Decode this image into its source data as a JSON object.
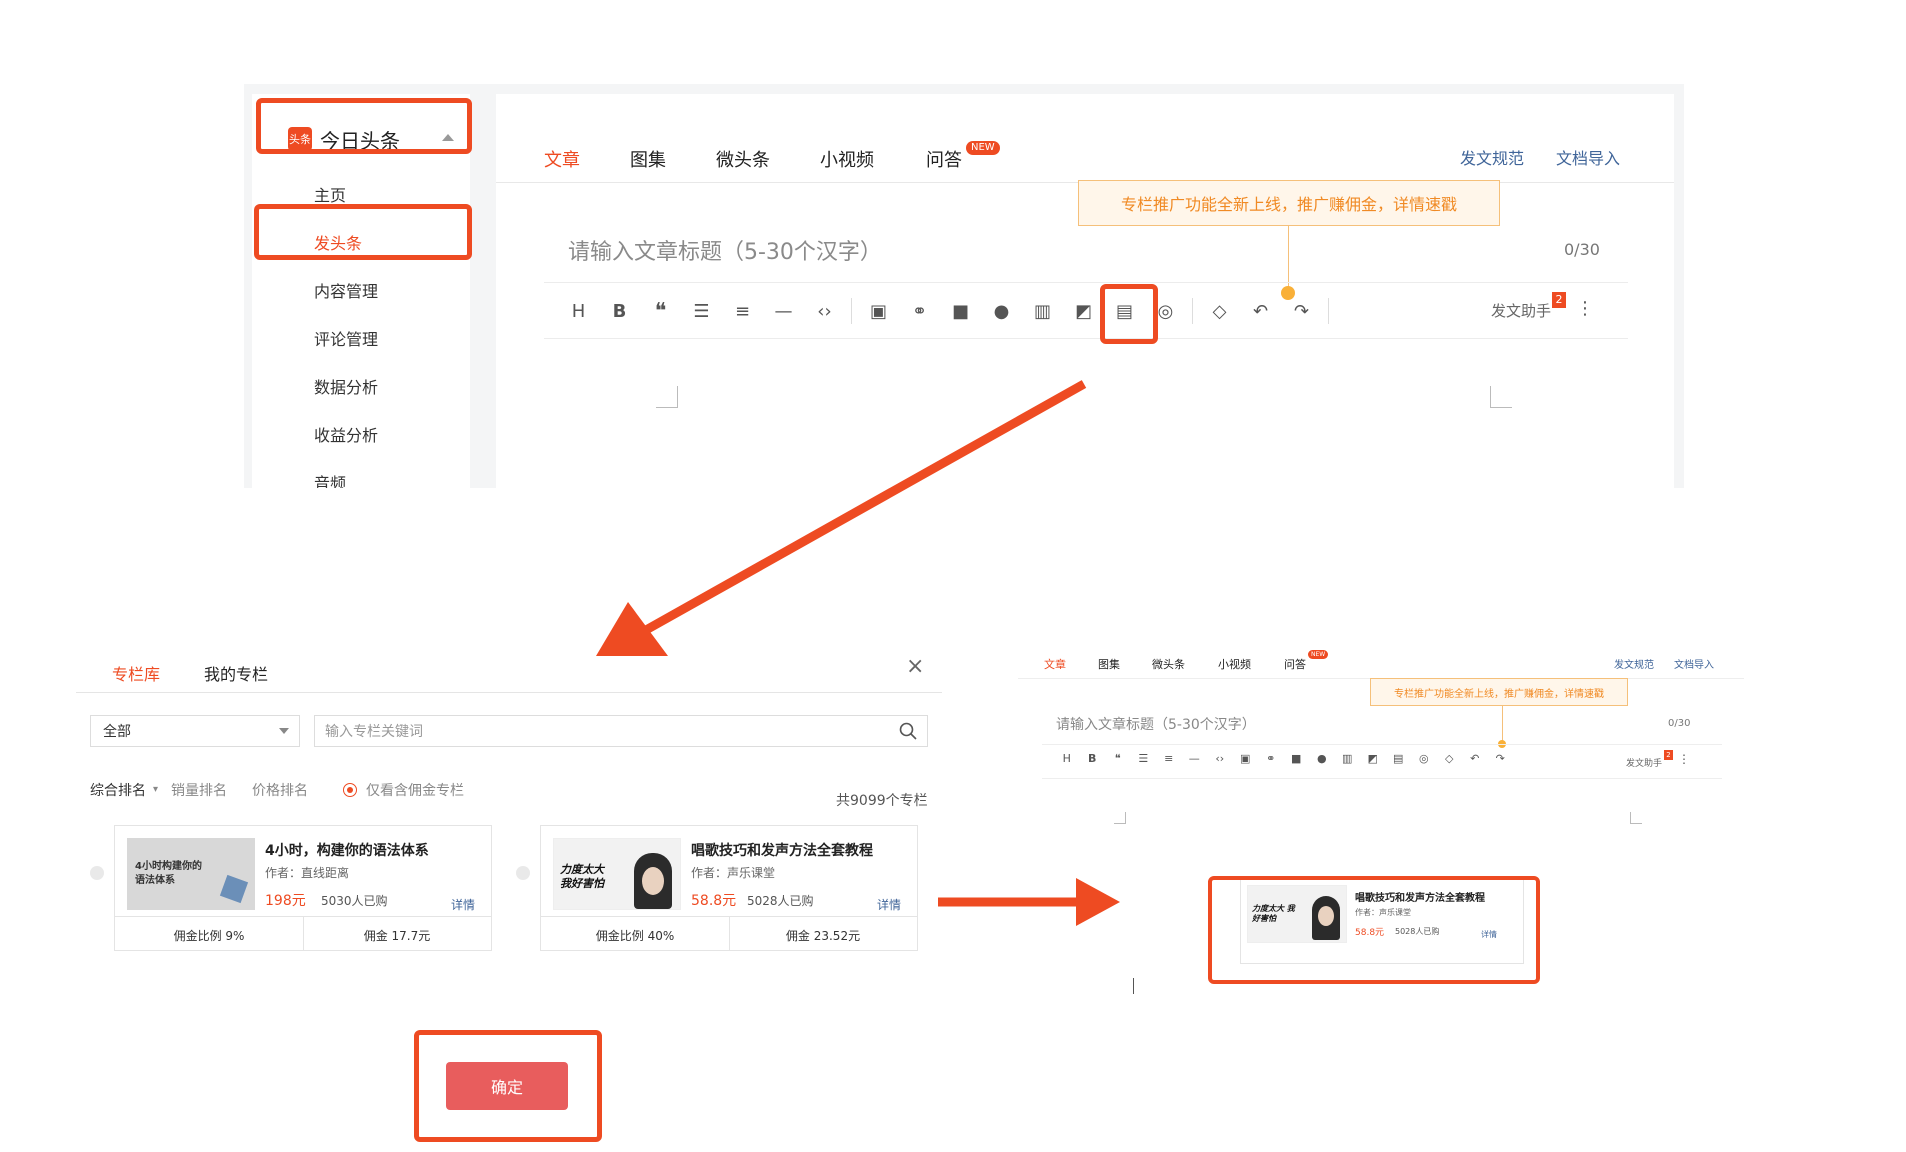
{
  "colors": {
    "accent": "#ee4b22",
    "link": "#406599",
    "tooltip_text": "#f08a24",
    "confirm": "#e85d5d"
  },
  "panel1": {
    "brand": {
      "logo": "头条",
      "name": "今日头条"
    },
    "nav": [
      "主页",
      "发头条",
      "内容管理",
      "评论管理",
      "数据分析",
      "收益分析",
      "音频"
    ],
    "tabs": [
      "文章",
      "图集",
      "微头条",
      "小视频",
      "问答"
    ],
    "new_badge": "NEW",
    "links": [
      "发文规范",
      "文档导入"
    ],
    "tooltip": "专栏推广功能全新上线，推广赚佣金，详情速戳",
    "title_placeholder": "请输入文章标题（5-30个汉字）",
    "title_count": "0/30",
    "toolbar_icons": [
      "heading-icon",
      "bold-icon",
      "quote-icon",
      "bullet-list-icon",
      "numbered-list-icon",
      "divider-icon",
      "code-icon",
      "image-icon",
      "link-icon",
      "video-icon",
      "audio-icon",
      "chart-icon",
      "gallery-icon",
      "column-icon",
      "vote-icon",
      "eraser-icon",
      "undo-icon",
      "redo-icon"
    ],
    "helper_label": "发文助手",
    "helper_badge": "2"
  },
  "panel2": {
    "tabs": [
      "专栏库",
      "我的专栏"
    ],
    "close": "×",
    "category_select": "全部",
    "search_placeholder": "输入专栏关键词",
    "sort_options": [
      "综合排名",
      "销量排名",
      "价格排名"
    ],
    "filter_label": "仅看含佣金专栏",
    "total": "共9099个专栏",
    "cards": [
      {
        "thumb_text": "4小时构建你的语法体系",
        "title": "4小时，构建你的语法体系",
        "author": "作者：直线距离",
        "price": "198元",
        "sold": "5030人已购",
        "detail": "详情",
        "commission_rate": "佣金比例 9%",
        "commission": "佣金 17.7元"
      },
      {
        "thumb_text": "力度太大 我好害怕",
        "title": "唱歌技巧和发声方法全套教程",
        "author": "作者：声乐课堂",
        "price": "58.8元",
        "sold": "5028人已购",
        "detail": "详情",
        "commission_rate": "佣金比例 40%",
        "commission": "佣金 23.52元"
      }
    ],
    "confirm": "确定"
  },
  "panel3": {
    "tabs": [
      "文章",
      "图集",
      "微头条",
      "小视频",
      "问答"
    ],
    "new_badge": "NEW",
    "links": [
      "发文规范",
      "文档导入"
    ],
    "tooltip": "专栏推广功能全新上线，推广赚佣金，详情速戳",
    "title_placeholder": "请输入文章标题（5-30个汉字）",
    "title_count": "0/30",
    "helper_label": "发文助手",
    "helper_badge": "2",
    "inserted_card": {
      "thumb_text": "力度太大 我好害怕",
      "title": "唱歌技巧和发声方法全套教程",
      "author": "作者：声乐课堂",
      "price": "58.8元",
      "sold": "5028人已购",
      "detail": "详情"
    }
  }
}
